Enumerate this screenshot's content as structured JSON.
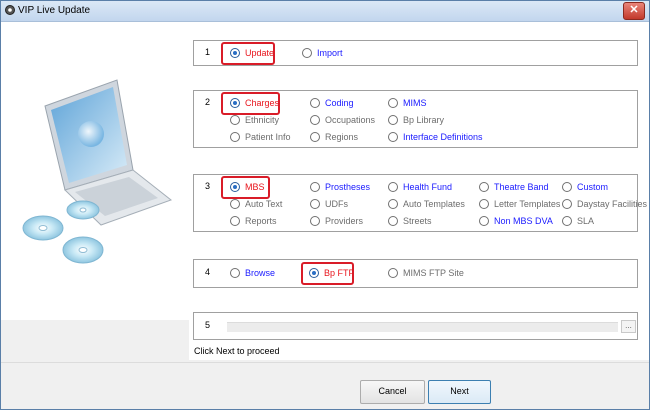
{
  "window": {
    "title": "VIP Live Update",
    "close_glyph": "✕"
  },
  "steps": {
    "s1": {
      "num": "1",
      "update": "Update",
      "import": "Import"
    },
    "s2": {
      "num": "2",
      "charges": "Charges",
      "coding": "Coding",
      "mims": "MIMS",
      "ethnicity": "Ethnicity",
      "occupations": "Occupations",
      "bp_library": "Bp Library",
      "patient_info": "Patient Info",
      "regions": "Regions",
      "interface_definitions": "Interface Definitions"
    },
    "s3": {
      "num": "3",
      "mbs": "MBS",
      "prostheses": "Prostheses",
      "health_fund": "Health Fund",
      "theatre_band": "Theatre Band",
      "custom": "Custom",
      "auto_text": "Auto Text",
      "udfs": "UDFs",
      "auto_templates": "Auto Templates",
      "letter_templates": "Letter Templates",
      "daystay_facilities": "Daystay Facilities",
      "reports": "Reports",
      "providers": "Providers",
      "streets": "Streets",
      "non_mbs_dva": "Non MBS DVA",
      "sla": "SLA"
    },
    "s4": {
      "num": "4",
      "browse": "Browse",
      "bp_ftp": "Bp FTP",
      "mims_ftp": "MIMS FTP Site"
    },
    "s5": {
      "num": "5",
      "browse_glyph": "..."
    }
  },
  "hint": "Click Next to proceed",
  "buttons": {
    "cancel": "Cancel",
    "next": "Next"
  },
  "colors": {
    "selected_highlight": "#d91c28",
    "link_blue": "#1a1aff",
    "accent_red": "#e8141c"
  }
}
